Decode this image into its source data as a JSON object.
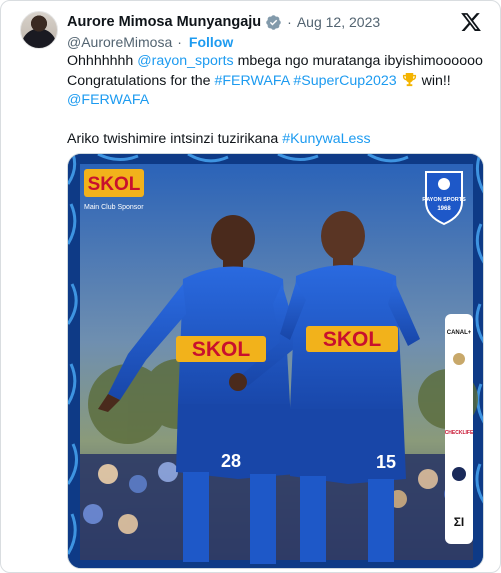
{
  "author": {
    "display_name": "Aurore Mimosa Munyangaju",
    "handle": "@AuroreMimosa",
    "date": "Aug 12, 2023",
    "follow_label": "Follow",
    "separator": "·"
  },
  "tweet": {
    "line1_prefix": "Ohhhhhhh ",
    "line1_mention": "@rayon_sports",
    "line1_suffix": " mbega ngo muratanga ibyishimoooooo",
    "line2_prefix": "Congratulations for the ",
    "line2_hashtag1": "#FERWAFA",
    "line2_hashtag2": "#SuperCup2023",
    "line2_suffix": " win!!",
    "line3_mention": "@FERWAFA",
    "line4_prefix": "Ariko twishimire intsinzi tuzirikana ",
    "line4_hashtag": "#KunywaLess"
  },
  "media": {
    "sponsor_logo": "SKOL",
    "sponsor_caption": "Main Club Sponsor",
    "club_badge_text": "RAYON SPORTS",
    "club_badge_year": "1968",
    "shirt_text": "SKOL",
    "player1_number": "28",
    "player2_number": "15",
    "side_sponsors": [
      "CANAL+",
      "CHECKLIFE",
      "ΣΙ"
    ]
  },
  "icons": {
    "verified": "verified-badge-icon",
    "x_logo": "x-logo-icon",
    "trophy": "trophy-emoji-icon"
  },
  "colors": {
    "link": "#1d9bf0",
    "muted": "#536471",
    "text": "#0f1419",
    "kit_blue": "#1e58c8",
    "skol_gold": "#f2b21b",
    "skol_red": "#c8102e"
  }
}
